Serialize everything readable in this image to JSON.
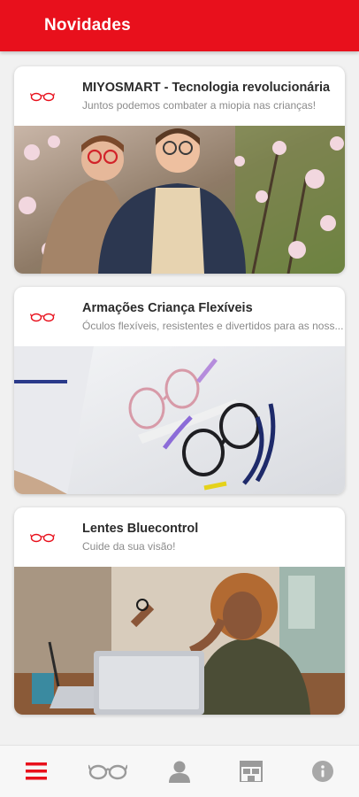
{
  "header": {
    "title": "Novidades"
  },
  "colors": {
    "brand_red": "#e8101c",
    "nav_icon_gray": "#9a9a9a"
  },
  "cards": [
    {
      "title": "MIYOSMART - Tecnologia revolucionária",
      "subtitle": "Juntos podemos combater a miopia nas crianças!",
      "logo_icon": "glasses-logo-icon",
      "image": "two-children-wearing-glasses-blossom-tree-photo"
    },
    {
      "title": "Armações Criança Flexíveis",
      "subtitle": "Óculos flexíveis, resistentes e divertidos para as noss...",
      "logo_icon": "glasses-logo-icon",
      "image": "flexible-kids-frames-on-white-cloth-photo"
    },
    {
      "title": "Lentes Bluecontrol",
      "subtitle": "Cuide da sua visão!",
      "logo_icon": "glasses-logo-icon",
      "image": "woman-rubbing-eyes-at-laptop-photo"
    }
  ],
  "bottom_nav": [
    {
      "icon": "menu-icon",
      "active": true
    },
    {
      "icon": "glasses-icon",
      "active": false
    },
    {
      "icon": "user-icon",
      "active": false
    },
    {
      "icon": "store-icon",
      "active": false
    },
    {
      "icon": "info-icon",
      "active": false
    }
  ]
}
